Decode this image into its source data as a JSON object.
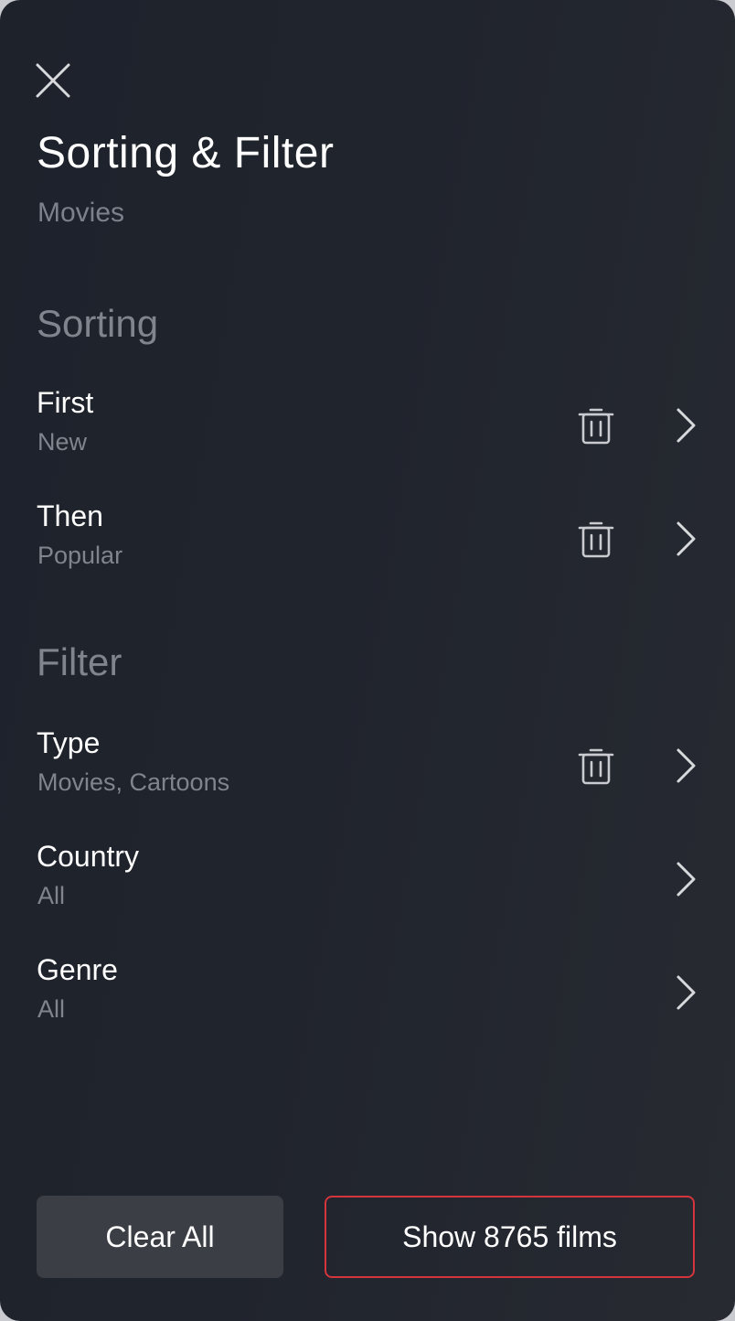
{
  "header": {
    "close_icon": "close-icon",
    "title": "Sorting & Filter",
    "subtitle": "Movies"
  },
  "sorting": {
    "heading": "Sorting",
    "items": [
      {
        "label": "First",
        "value": "New",
        "has_delete": true,
        "delete_icon": "trash-icon",
        "chevron_icon": "chevron-right-icon"
      },
      {
        "label": "Then",
        "value": "Popular",
        "has_delete": true,
        "delete_icon": "trash-icon",
        "chevron_icon": "chevron-right-icon"
      }
    ]
  },
  "filter": {
    "heading": "Filter",
    "items": [
      {
        "label": "Type",
        "value": "Movies, Cartoons",
        "has_delete": true,
        "delete_icon": "trash-icon",
        "chevron_icon": "chevron-right-icon"
      },
      {
        "label": "Country",
        "value": "All",
        "has_delete": false,
        "chevron_icon": "chevron-right-icon"
      },
      {
        "label": "Genre",
        "value": "All",
        "has_delete": false,
        "chevron_icon": "chevron-right-icon"
      }
    ]
  },
  "actions": {
    "clear_label": "Clear All",
    "show_label": "Show 8765 films"
  },
  "colors": {
    "background": "#20242d",
    "text_primary": "#ffffff",
    "text_secondary": "#80848d",
    "clear_button_bg": "#3b3e45",
    "accent_border": "#d4343d"
  }
}
